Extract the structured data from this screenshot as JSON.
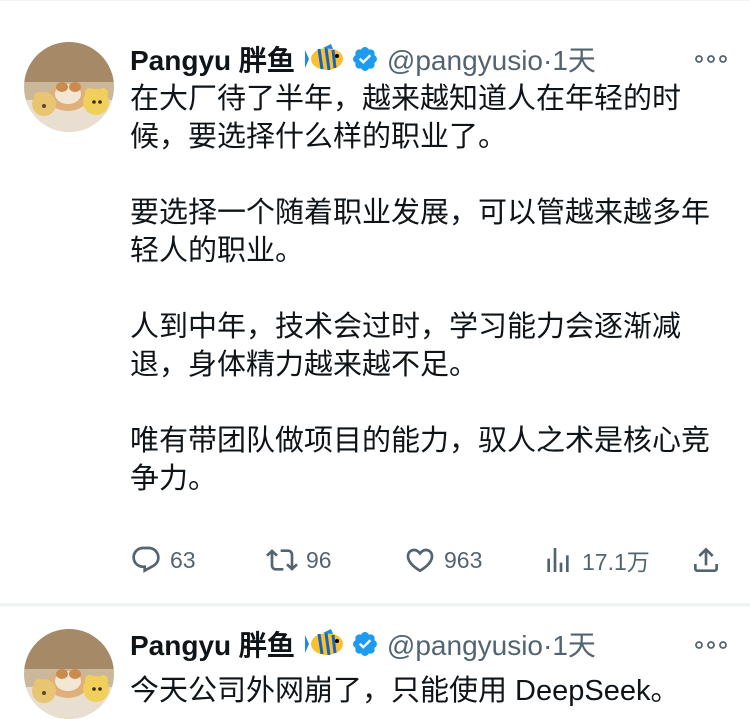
{
  "tweets": [
    {
      "author": {
        "name": "Pangyu 胖鱼",
        "handle": "@pangyusio",
        "separator": "·",
        "time": "1天"
      },
      "paragraphs": [
        "在大厂待了半年，越来越知道人在年轻的时候，要选择什么样的职业了。",
        "要选择一个随着职业发展，可以管越来越多年轻人的职业。",
        "人到中年，技术会过时，学习能力会逐渐减退，身体精力越来越不足。",
        "唯有带团队做项目的能力，驭人之术是核心竞争力。"
      ],
      "actions": {
        "replies": "63",
        "retweets": "96",
        "likes": "963",
        "views": "17.1万"
      }
    },
    {
      "author": {
        "name": "Pangyu 胖鱼",
        "handle": "@pangyusio",
        "separator": "·",
        "time": "1天"
      },
      "paragraphs": [
        "今天公司外网崩了，只能使用 DeepSeek。"
      ]
    }
  ],
  "icons": {
    "reply": "speech-bubble-icon",
    "retweet": "retweet-arrows-icon",
    "like": "heart-icon",
    "views": "bar-chart-icon",
    "share": "share-upload-icon",
    "more": "more-dots-icon",
    "verified": "verified-badge-icon",
    "emoji": "tropical-fish-emoji"
  },
  "colors": {
    "text": "#0f1419",
    "secondary": "#536471",
    "verified": "#1d9bf0",
    "divider": "#eff3f4"
  }
}
